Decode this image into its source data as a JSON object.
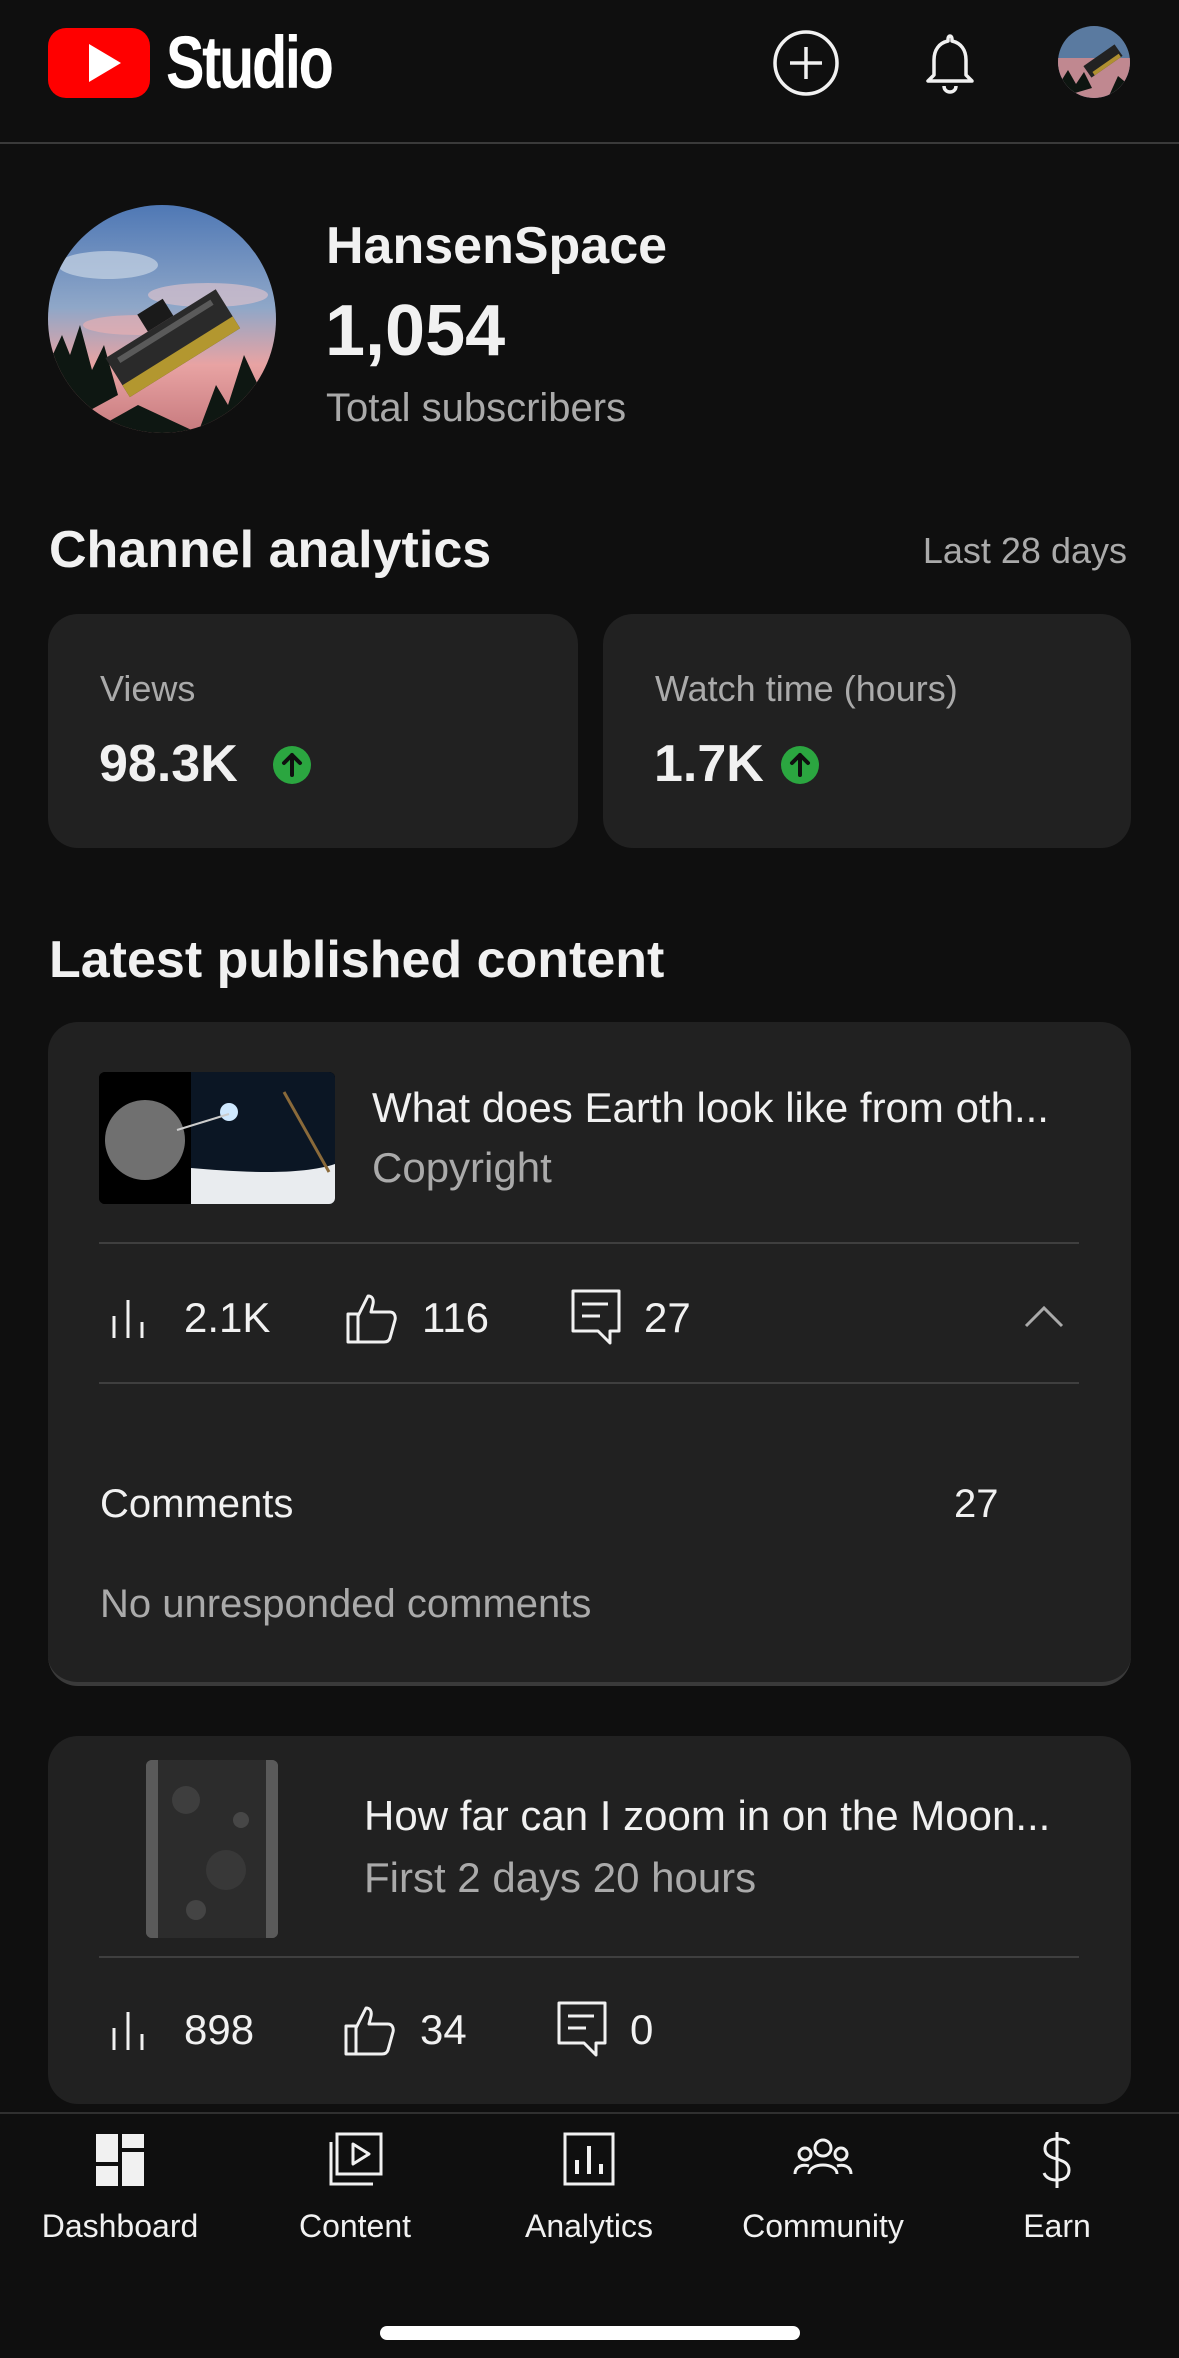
{
  "header": {
    "app_name": "Studio",
    "icons": [
      "create-icon",
      "notifications-bell-icon",
      "account-avatar"
    ]
  },
  "channel": {
    "name": "HansenSpace",
    "subscribers": "1,054",
    "subscribers_label": "Total subscribers"
  },
  "analytics": {
    "title": "Channel analytics",
    "period": "Last 28 days",
    "metrics": [
      {
        "label": "Views",
        "value": "98.3K",
        "trend": "up"
      },
      {
        "label": "Watch time (hours)",
        "value": "1.7K",
        "trend": "up"
      }
    ]
  },
  "latest": {
    "title": "Latest published content",
    "items": [
      {
        "title": "What does Earth look like from oth...",
        "subtitle": "Copyright",
        "views": "2.1K",
        "likes": "116",
        "comments": "27",
        "comments_label": "Comments",
        "comments_count": "27",
        "comments_status": "No unresponded comments"
      },
      {
        "title": "How far can I zoom in on the Moon...",
        "subtitle": "First 2 days 20 hours",
        "views": "898",
        "likes": "34",
        "comments": "0"
      }
    ]
  },
  "nav": {
    "items": [
      {
        "label": "Dashboard",
        "icon": "dashboard-icon"
      },
      {
        "label": "Content",
        "icon": "content-icon"
      },
      {
        "label": "Analytics",
        "icon": "analytics-icon"
      },
      {
        "label": "Community",
        "icon": "community-icon"
      },
      {
        "label": "Earn",
        "icon": "earn-icon"
      }
    ]
  },
  "colors": {
    "background": "#0f0f0f",
    "card": "#212121",
    "brand_red": "#ff0000",
    "trend_green": "#2ba640",
    "muted_text": "#aaaaaa"
  }
}
